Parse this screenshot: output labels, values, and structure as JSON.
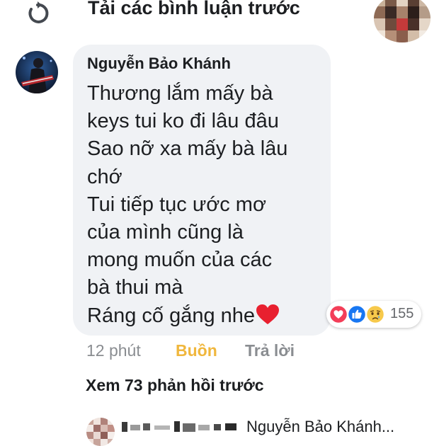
{
  "header": {
    "load_previous_label": "Tải các bình luận trước",
    "refresh_icon": "refresh-icon"
  },
  "comment": {
    "author": "Nguyễn Bảo Khánh",
    "lines": [
      "Thương lắm mấy bà",
      "keys tui ko đi lâu đâu",
      "Sao nỡ xa mấy bà lâu",
      "chớ",
      "Tui tiếp tục ước mơ",
      "của mình cũng là",
      "mong muốn của các",
      "bà thui mà",
      "Ráng cố gắng nhe"
    ],
    "trailing_emoji": "heart-emoji",
    "time": "12 phút",
    "reaction_label": "Buồn",
    "reply_label": "Trả lời",
    "reactions": {
      "icons": [
        "love-reaction-icon",
        "like-reaction-icon",
        "sad-reaction-icon"
      ],
      "count": "155"
    }
  },
  "replies": {
    "view_more_label": "Xem 73 phản hồi trước",
    "preview_text": "Nguyễn Bảo Khánh..."
  },
  "colors": {
    "bubble": "#f0f2f5",
    "text": "#1c1e21",
    "muted": "#8a8d91",
    "sad_reaction": "#f0b73d",
    "love": "#f33e58",
    "like": "#1877f2"
  }
}
